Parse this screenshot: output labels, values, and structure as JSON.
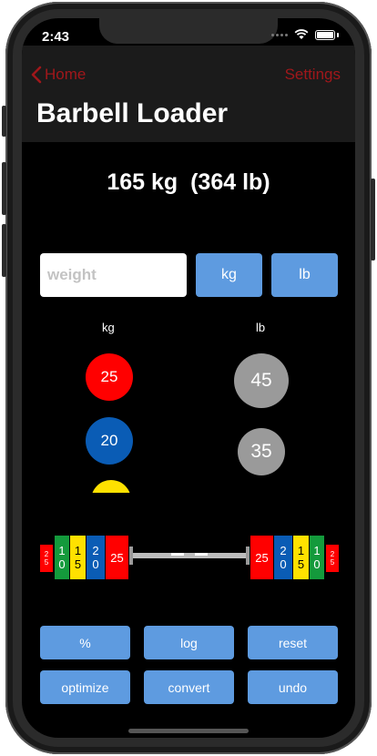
{
  "status": {
    "time": "2:43"
  },
  "nav": {
    "back_label": "Home",
    "settings_label": "Settings",
    "title": "Barbell Loader"
  },
  "total_display": "165 kg  (364 lb)",
  "weight_input": {
    "placeholder": "weight",
    "value": ""
  },
  "unit_buttons": {
    "kg": "kg",
    "lb": "lb"
  },
  "plate_columns": {
    "kg_label": "kg",
    "lb_label": "lb",
    "kg_plates": [
      {
        "value": "25",
        "color": "#ff0000"
      },
      {
        "value": "20",
        "color": "#0a5cb5"
      },
      {
        "value": "",
        "color": "#ffe100"
      }
    ],
    "lb_plates": [
      {
        "value": "45",
        "color": "#9a9a9a"
      },
      {
        "value": "35",
        "color": "#9a9a9a"
      }
    ]
  },
  "barbell": {
    "left_plates": [
      {
        "digits": [
          "2",
          "5"
        ],
        "color": "#ff0000"
      },
      {
        "digits": [
          "1",
          "0"
        ],
        "color": "#149a3c"
      },
      {
        "digits": [
          "1",
          "5"
        ],
        "color": "#ffe100"
      },
      {
        "digits": [
          "2",
          "0"
        ],
        "color": "#0a5cb5"
      },
      {
        "digits": [
          "25"
        ],
        "color": "#ff0000"
      }
    ],
    "right_plates": [
      {
        "digits": [
          "25"
        ],
        "color": "#ff0000"
      },
      {
        "digits": [
          "2",
          "0"
        ],
        "color": "#0a5cb5"
      },
      {
        "digits": [
          "1",
          "5"
        ],
        "color": "#ffe100"
      },
      {
        "digits": [
          "1",
          "0"
        ],
        "color": "#149a3c"
      },
      {
        "digits": [
          "2",
          "5"
        ],
        "color": "#ff0000"
      }
    ]
  },
  "actions": {
    "percent": "%",
    "log": "log",
    "reset": "reset",
    "optimize": "optimize",
    "convert": "convert",
    "undo": "undo"
  },
  "colors": {
    "accent": "#5e9be0",
    "nav_tint": "#a0171b"
  }
}
